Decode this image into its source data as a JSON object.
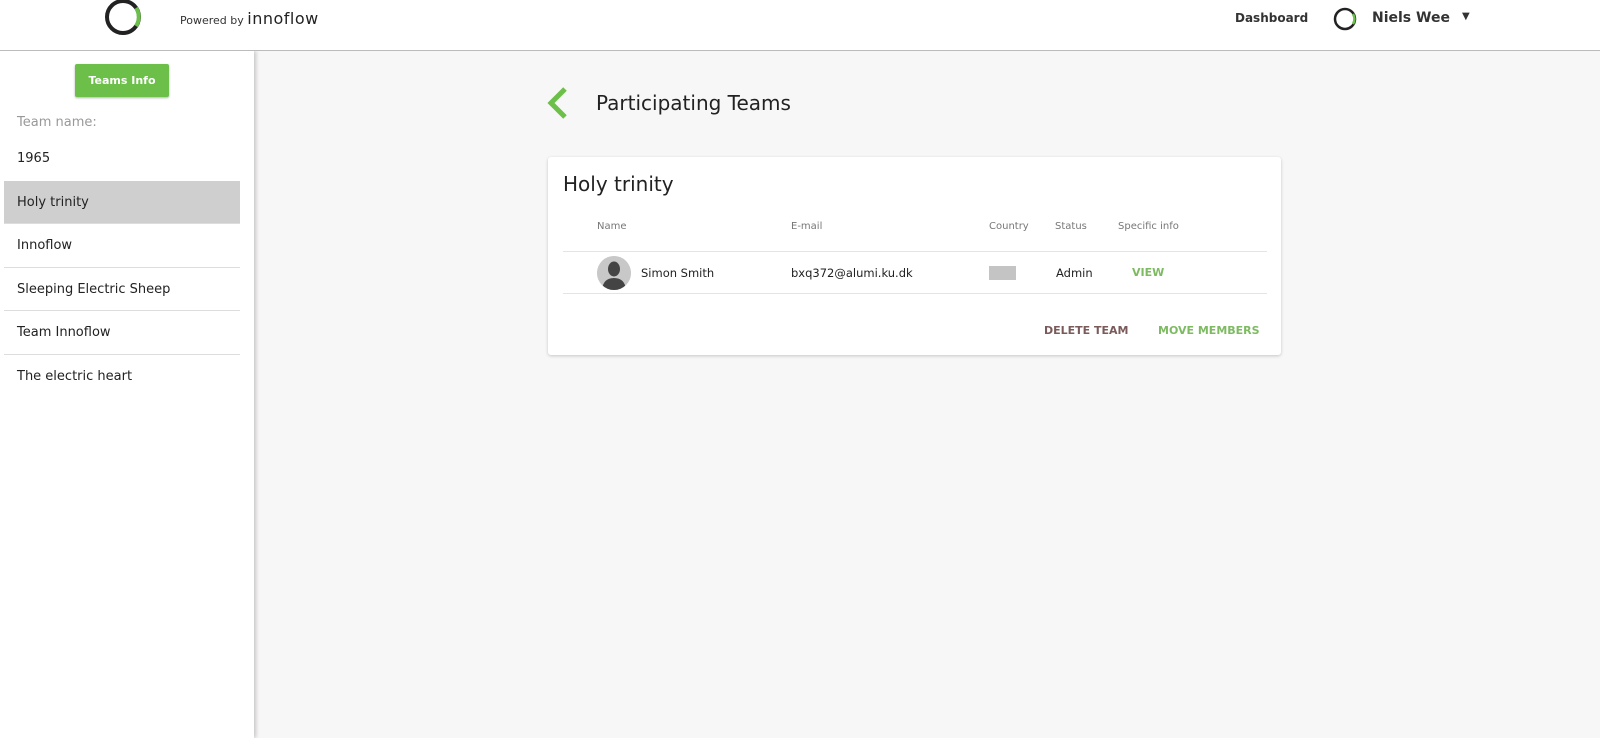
{
  "header": {
    "powered_by": "Powered by",
    "brand": "innoflow",
    "nav_dashboard": "Dashboard",
    "user_name": "Niels Wee",
    "dropdown_icon": "caret-down-icon"
  },
  "sidebar": {
    "teams_info_button": "Teams Info",
    "team_name_label": "Team name:",
    "teams": [
      {
        "label": "1965"
      },
      {
        "label": "Holy trinity"
      },
      {
        "label": "Innoflow"
      },
      {
        "label": "Sleeping Electric Sheep"
      },
      {
        "label": "Team Innoflow"
      },
      {
        "label": "The electric heart"
      }
    ],
    "selected": "Holy trinity"
  },
  "main": {
    "title": "Participating Teams",
    "card": {
      "team_name": "Holy trinity",
      "columns": [
        "Name",
        "E-mail",
        "Country",
        "Status",
        "Specific info"
      ],
      "members": [
        {
          "name": "Simon Smith",
          "email": "bxq372@alumi.ku.dk",
          "status": "Admin",
          "action": "VIEW"
        }
      ],
      "delete_button": "DELETE TEAM",
      "move_button": "MOVE MEMBERS"
    }
  },
  "colors": {
    "accent": "#6cc04a",
    "delete": "#7a5a5a",
    "selected_bg": "#cfcfcf"
  }
}
